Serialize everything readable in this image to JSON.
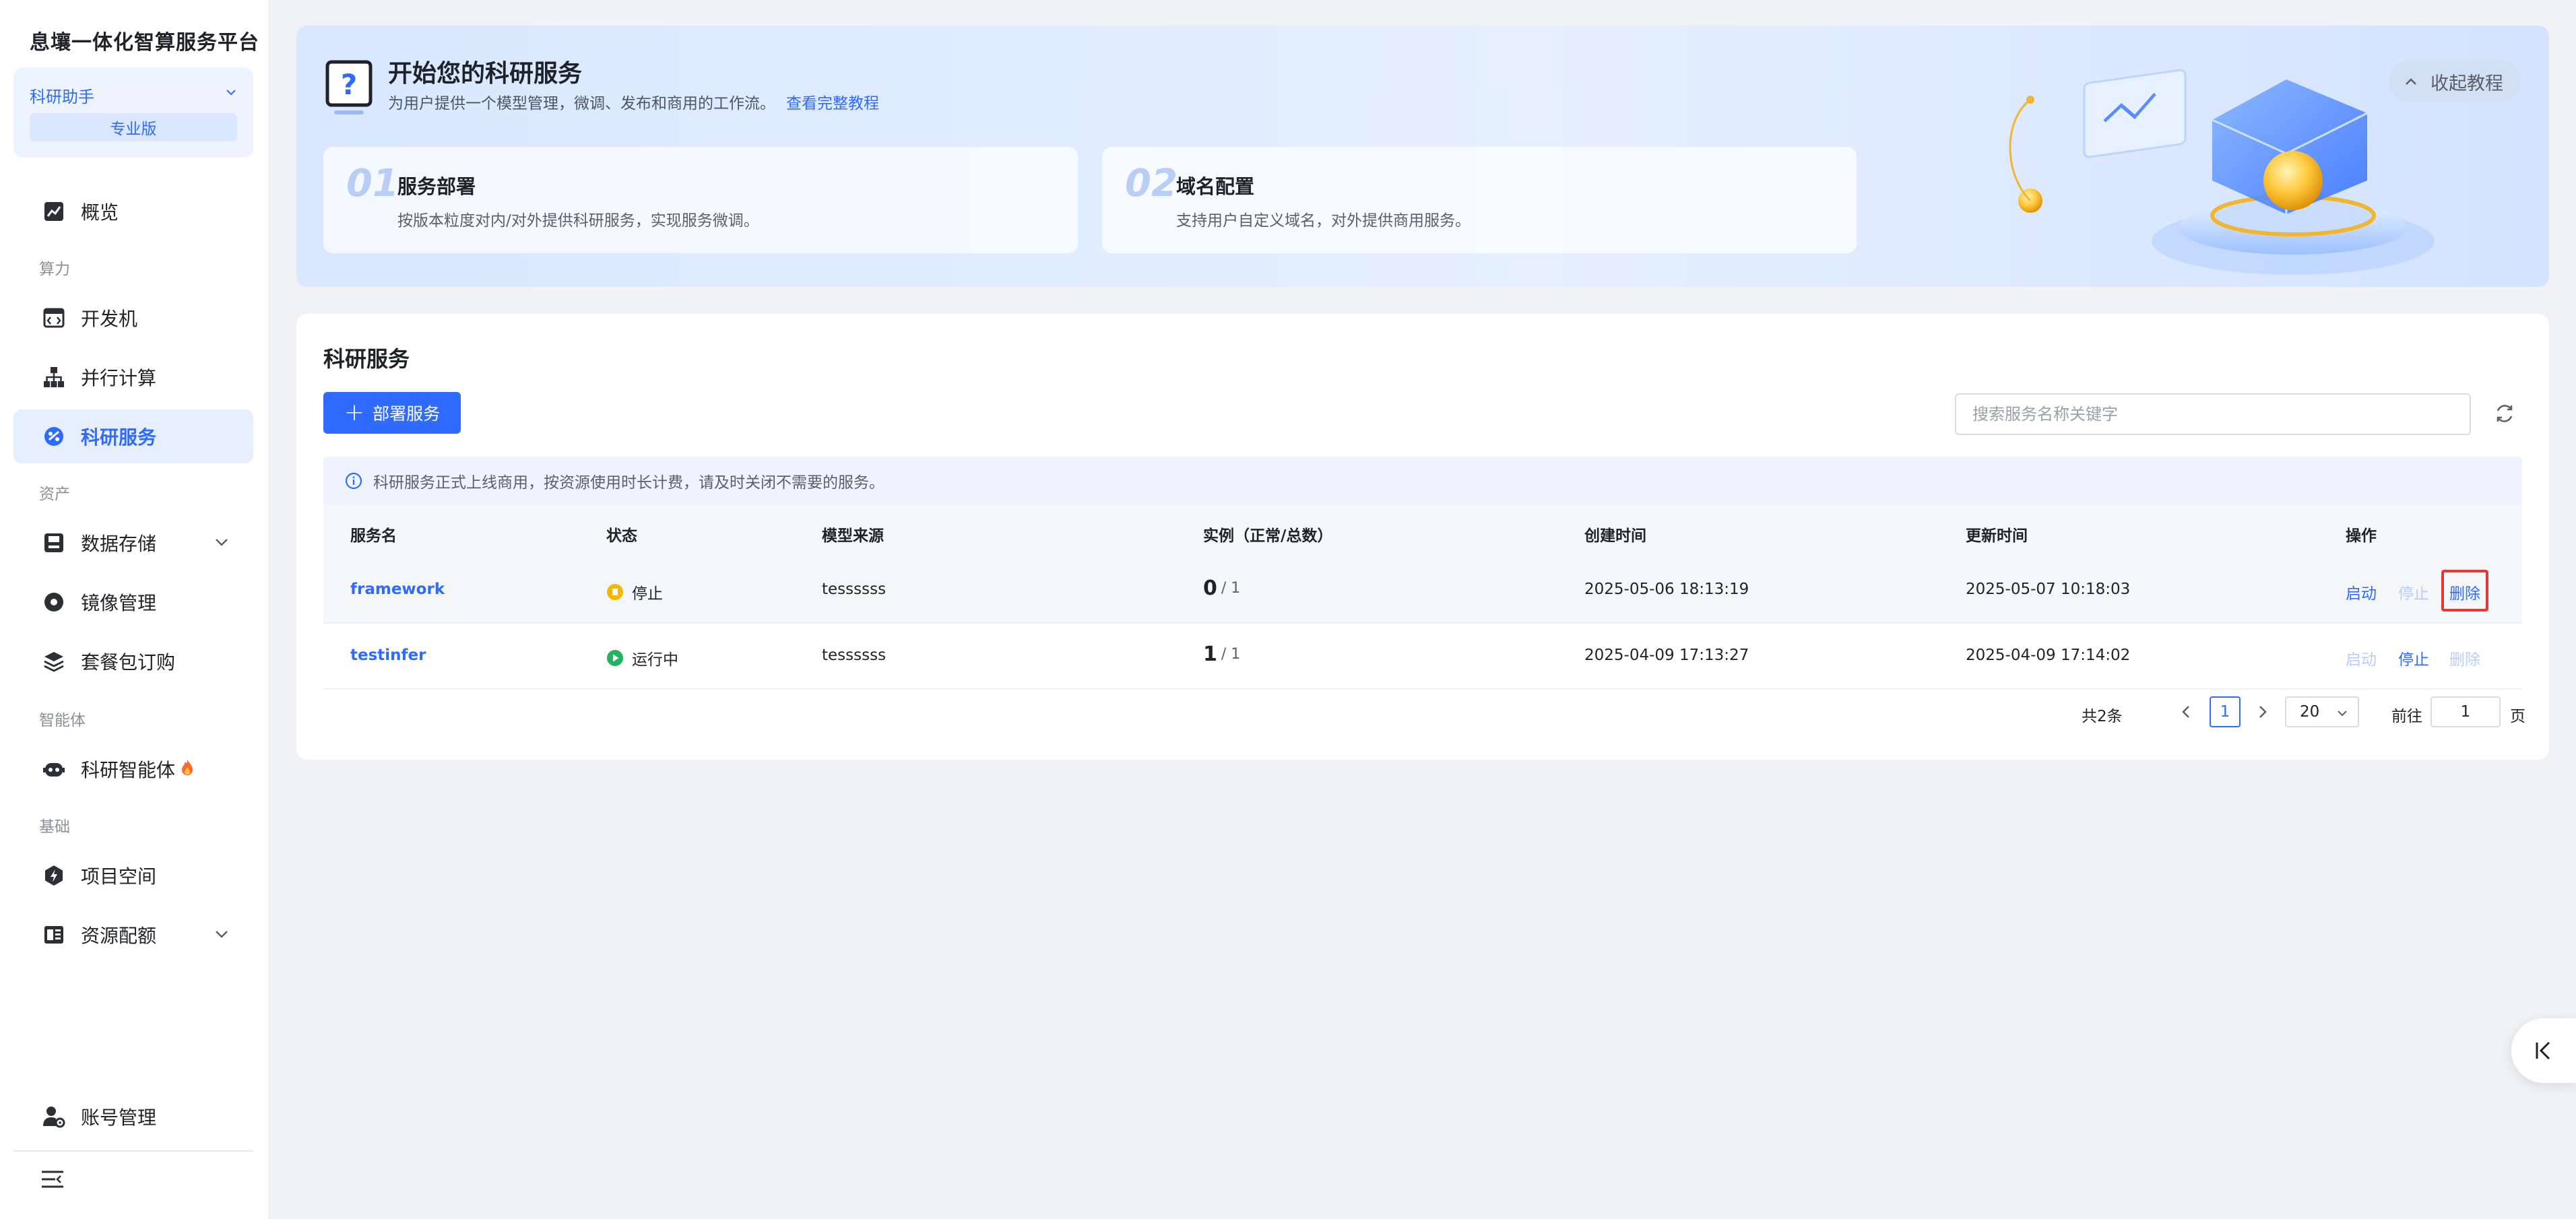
{
  "app": {
    "brand": "息壤一体化智算服务平台"
  },
  "workspace": {
    "name": "科研助手",
    "edition": "专业版"
  },
  "sidebar": {
    "overview": "概览",
    "groups": {
      "compute": "算力",
      "assets": "资产",
      "agent": "智能体",
      "base": "基础"
    },
    "items": {
      "devbox": "开发机",
      "parallel": "并行计算",
      "research_service": "科研服务",
      "storage": "数据存储",
      "images": "镜像管理",
      "packages": "套餐包订购",
      "agent": "科研智能体",
      "project": "项目空间",
      "quota": "资源配额",
      "account": "账号管理"
    }
  },
  "banner": {
    "title": "开始您的科研服务",
    "desc": "为用户提供一个模型管理，微调、发布和商用的工作流。",
    "link": "查看完整教程",
    "fold": "收起教程",
    "steps": [
      {
        "num": "01",
        "title": "服务部署",
        "desc": "按版本粒度对内/对外提供科研服务，实现服务微调。"
      },
      {
        "num": "02",
        "title": "域名配置",
        "desc": "支持用户自定义域名，对外提供商用服务。"
      }
    ]
  },
  "main": {
    "title": "科研服务",
    "deploy_button": "部署服务",
    "search_placeholder": "搜索服务名称关键字",
    "notice": "科研服务正式上线商用，按资源使用时长计费，请及时关闭不需要的服务。",
    "columns": {
      "name": "服务名",
      "status": "状态",
      "source": "模型来源",
      "instances": "实例（正常/总数）",
      "created": "创建时间",
      "updated": "更新时间",
      "ops": "操作"
    },
    "rows": [
      {
        "name": "framework",
        "status": "停止",
        "status_color": "#f5b800",
        "source": "tessssss",
        "inst_normal": "0",
        "inst_total": "/ 1",
        "created": "2025-05-06 18:13:19",
        "updated": "2025-05-07 10:18:03",
        "op_start": "启动",
        "op_stop": "停止",
        "op_delete": "删除"
      },
      {
        "name": "testinfer",
        "status": "运行中",
        "status_color": "#22b35e",
        "source": "tessssss",
        "inst_normal": "1",
        "inst_total": "/ 1",
        "created": "2025-04-09 17:13:27",
        "updated": "2025-04-09 17:14:02",
        "op_start": "启动",
        "op_stop": "停止",
        "op_delete": "删除"
      }
    ]
  },
  "pagination": {
    "total": "共2条",
    "page": "1",
    "page_size": "20",
    "goto_label": "前往",
    "goto_value": "1",
    "unit": "页"
  },
  "colors": {
    "primary": "#2f6bff",
    "highlight": "#e53935"
  }
}
